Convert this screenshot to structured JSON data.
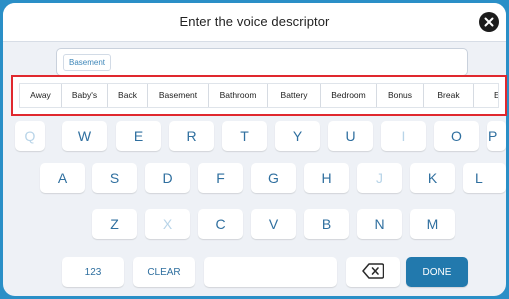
{
  "header": {
    "title": "Enter the voice descriptor"
  },
  "input": {
    "chip": "Basement"
  },
  "suggestions": [
    "Away",
    "Baby's",
    "Back",
    "Basement",
    "Bathroom",
    "Battery",
    "Bedroom",
    "Bonus",
    "Break",
    "E"
  ],
  "keyboard": {
    "row1": [
      "Q",
      "W",
      "E",
      "R",
      "T",
      "Y",
      "U",
      "I",
      "O",
      "P"
    ],
    "row2": [
      "A",
      "S",
      "D",
      "F",
      "G",
      "H",
      "J",
      "K",
      "L"
    ],
    "row3": [
      "Z",
      "X",
      "C",
      "V",
      "B",
      "N",
      "M"
    ],
    "disabled_keys": [
      "Q",
      "I",
      "J",
      "X"
    ],
    "numbers_label": "123",
    "clear_label": "CLEAR",
    "space_label": "",
    "done_label": "DONE"
  },
  "colors": {
    "frame": "#2a8fc7",
    "key_text": "#2f6f9f",
    "key_disabled": "#b8d4e8",
    "done_bg": "#2279ad",
    "highlight": "#e0282e"
  },
  "icons": {
    "close": "close-icon",
    "backspace": "backspace-icon"
  }
}
